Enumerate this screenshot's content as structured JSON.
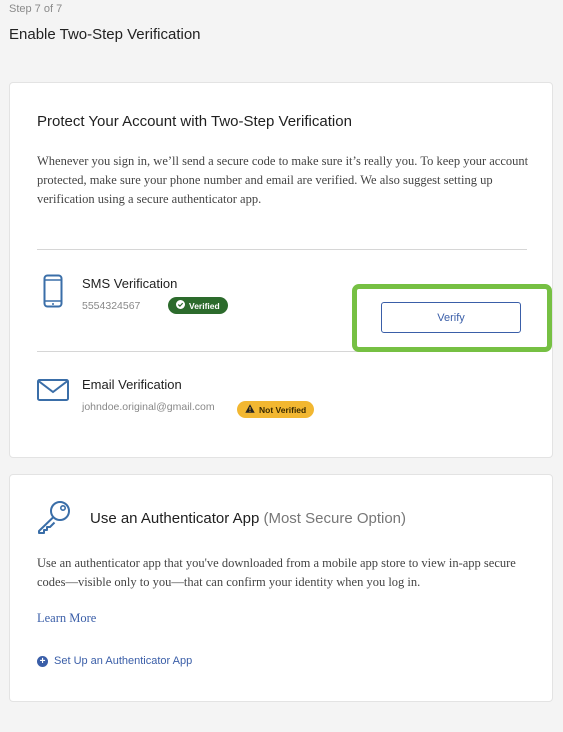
{
  "header": {
    "step": "Step 7 of 7",
    "title": "Enable Two-Step Verification"
  },
  "protect_card": {
    "title": "Protect Your Account with Two-Step Verification",
    "description": "Whenever you sign in, we’ll send a secure code to make sure it’s really you. To keep your account protected, make sure your phone number and email are verified. We also suggest setting up verification using a secure authenticator app.",
    "sms": {
      "icon": "phone-icon",
      "title": "SMS Verification",
      "value": "5554324567",
      "badge": "Verified",
      "badge_color": "#2c6b2c"
    },
    "email": {
      "icon": "envelope-icon",
      "title": "Email Verification",
      "value": "johndoe.original@gmail.com",
      "badge": "Not Verified",
      "badge_color": "#f2b731",
      "verify_button": "Verify",
      "highlight_color": "#76c043"
    }
  },
  "auth_card": {
    "icon": "key-icon",
    "title": "Use an Authenticator App",
    "title_note": "(Most Secure Option)",
    "description": "Use an authenticator app that you've downloaded from a mobile app store to view in-app secure codes—visible only to you—that can confirm your identity when you log in.",
    "learn_more": "Learn More",
    "setup_link": "Set Up an Authenticator App"
  }
}
